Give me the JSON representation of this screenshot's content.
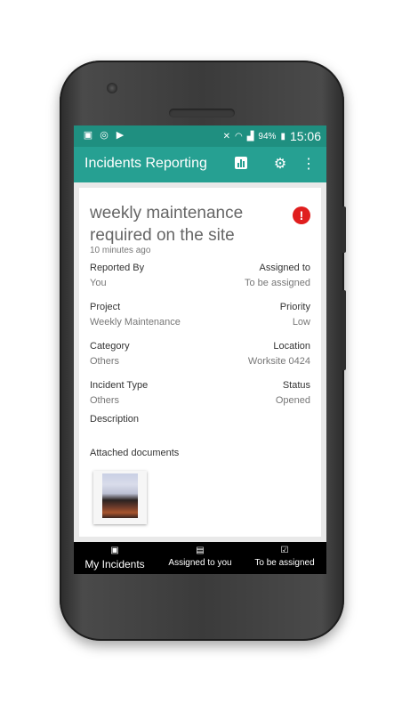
{
  "status_bar": {
    "battery": "94%",
    "time": "15:06"
  },
  "app_bar": {
    "title": "Incidents Reporting"
  },
  "incident": {
    "title": "weekly maintenance required on the site",
    "time_ago": "10 minutes ago",
    "fields": {
      "reported_by_label": "Reported By",
      "reported_by_value": "You",
      "assigned_to_label": "Assigned to",
      "assigned_to_value": "To be assigned",
      "project_label": "Project",
      "project_value": "Weekly Maintenance",
      "priority_label": "Priority",
      "priority_value": "Low",
      "category_label": "Category",
      "category_value": "Others",
      "location_label": "Location",
      "location_value": "Worksite 0424",
      "incident_type_label": "Incident Type",
      "incident_type_value": "Others",
      "status_label": "Status",
      "status_value": "Opened",
      "description_label": "Description"
    },
    "attached_documents_label": "Attached documents"
  },
  "bottom_nav": {
    "my_incidents": "My Incidents",
    "assigned_to_you": "Assigned to you",
    "to_be_assigned": "To be assigned"
  },
  "colors": {
    "status_bar": "#1f8f80",
    "app_bar": "#26a092",
    "alert": "#e01e1e",
    "bottom_nav": "#000000"
  }
}
